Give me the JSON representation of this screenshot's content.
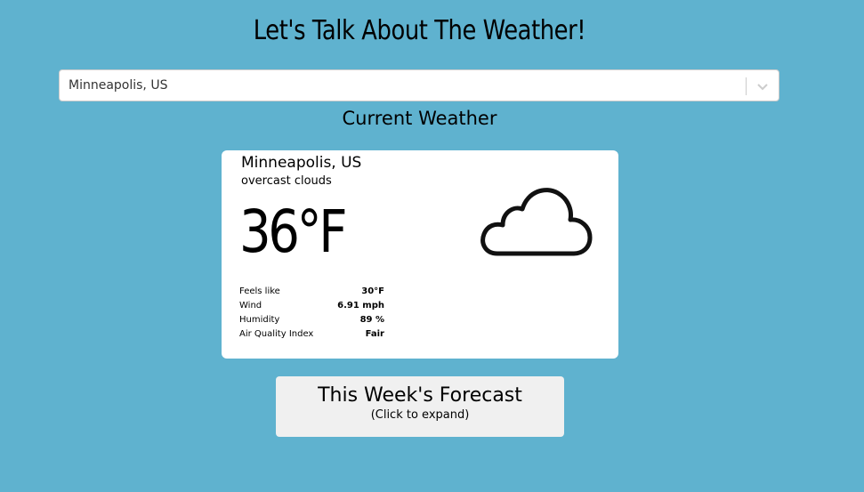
{
  "page": {
    "title": "Let's Talk About The Weather!"
  },
  "location_select": {
    "value": "Minneapolis, US",
    "icon": "chevron-down-icon"
  },
  "current": {
    "heading": "Current Weather",
    "city": "Minneapolis, US",
    "description": "overcast clouds",
    "temperature": "36°F",
    "icon": "cloud-icon",
    "details": [
      {
        "label": "Feels like",
        "value": "30°F"
      },
      {
        "label": "Wind",
        "value": "6.91 mph"
      },
      {
        "label": "Humidity",
        "value": "89 %"
      },
      {
        "label": "Air Quality Index",
        "value": "Fair"
      }
    ]
  },
  "forecast": {
    "title": "This Week's Forecast",
    "subtitle": "(Click to expand)"
  },
  "colors": {
    "background": "#5fb2cf",
    "card": "#ffffff",
    "forecast_button": "#f0f0f0"
  }
}
